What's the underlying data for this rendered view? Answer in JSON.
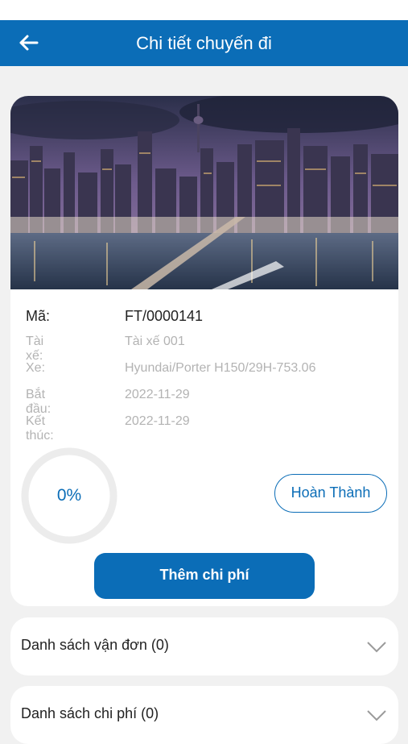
{
  "appbar": {
    "title": "Chi tiết chuyến đi",
    "back_icon": "arrow-left-icon"
  },
  "trip": {
    "code_label": "Mã:",
    "code_value": "FT/0000141",
    "driver_label": "Tài xế:",
    "driver_value": "Tài xế 001",
    "vehicle_label": "Xe:",
    "vehicle_value": "Hyundai/Porter H150/29H-753.06",
    "start_label": "Bắt đầu:",
    "start_value": "2022-11-29",
    "end_label": "Kết thúc:",
    "end_value": "2022-11-29"
  },
  "progress": {
    "percent": 0,
    "label": "0%"
  },
  "buttons": {
    "complete": "Hoàn Thành",
    "add_cost": "Thêm chi phí"
  },
  "sections": {
    "waybills": "Danh sách vận đơn (0)",
    "costs": "Danh sách chi phí (0)"
  },
  "colors": {
    "primary": "#0b6db7",
    "background": "#f1f1f1"
  }
}
